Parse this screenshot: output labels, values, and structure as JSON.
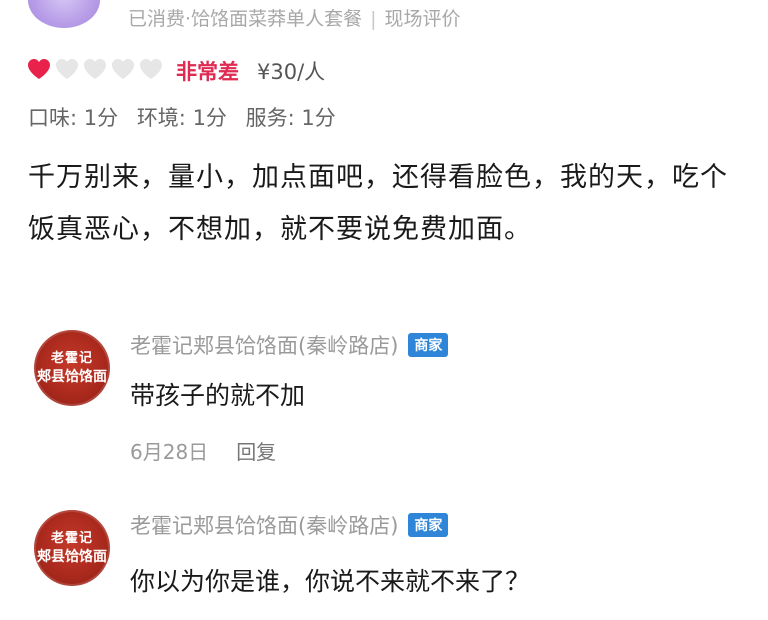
{
  "header": {
    "status": "已消费",
    "package": "饸饹面菜莽单人套餐",
    "source": "现场评价"
  },
  "rating": {
    "hearts_filled": 1,
    "hearts_total": 5,
    "label": "非常差",
    "price": "¥30/人",
    "colors": {
      "filled": "#e8224a",
      "empty": "#e6e6e6"
    }
  },
  "scores": {
    "taste": "口味: 1分",
    "environment": "环境: 1分",
    "service": "服务: 1分"
  },
  "review": {
    "text": "千万别来，量小，加点面吧，还得看脸色，我的天，吃个饭真恶心，不想加，就不要说免费加面。"
  },
  "replies": [
    {
      "avatar_line1": "老霍记",
      "avatar_line2": "郏县饸饹面",
      "name": "老霍记郏县饸饹面(秦岭路店)",
      "badge": "商家",
      "text": "带孩子的就不加",
      "date": "6月28日",
      "reply_label": "回复"
    },
    {
      "avatar_line1": "老霍记",
      "avatar_line2": "郏县饸饹面",
      "name": "老霍记郏县饸饹面(秦岭路店)",
      "badge": "商家",
      "text": "你以为你是谁，你说不来就不来了？",
      "date": "",
      "reply_label": ""
    }
  ]
}
